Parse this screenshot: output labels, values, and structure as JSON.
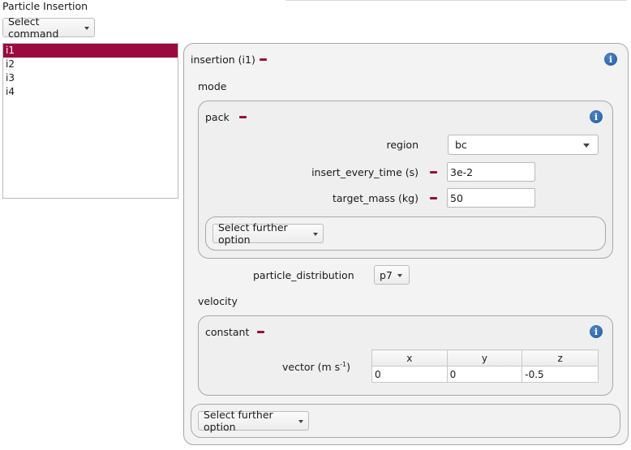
{
  "window": {
    "title": "Particle Insertion"
  },
  "toolbar": {
    "select_command_label": "Select command"
  },
  "list": {
    "items": [
      "i1",
      "i2",
      "i3",
      "i4"
    ],
    "selected_index": 0
  },
  "insertion": {
    "header": "insertion (i1)",
    "mode_label": "mode",
    "pack": {
      "header": "pack",
      "region_label": "region",
      "region_value": "bc",
      "insert_every_time_label": "insert_every_time (s)",
      "insert_every_time_value": "3e-2",
      "target_mass_label": "target_mass (kg)",
      "target_mass_value": "50",
      "further_option_label": "Select further option"
    },
    "particle_distribution_label": "particle_distribution",
    "particle_distribution_value": "p7",
    "velocity_label": "velocity",
    "constant": {
      "header": "constant",
      "vector_label": "vector (m s",
      "vector_sup": "-1",
      "vector_close": ")",
      "columns": [
        "x",
        "y",
        "z"
      ],
      "values": [
        "0",
        "0",
        "-0.5"
      ]
    },
    "further_option_label": "Select further option"
  },
  "icons": {
    "info": "info-icon",
    "remove": "minus-icon",
    "dropdown": "chevron-down-icon"
  },
  "colors": {
    "accent": "#9a0a3e",
    "info": "#1e5a9e"
  }
}
